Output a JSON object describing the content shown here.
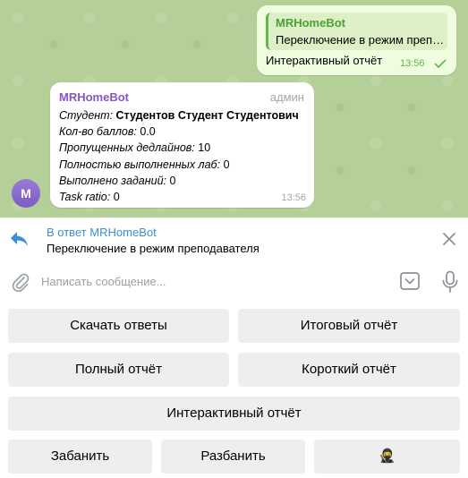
{
  "outgoing": {
    "reply_name": "MRHomeBot",
    "reply_text": "Переключение в режим преподавателя",
    "text": "Интерактивный отчёт",
    "time": "13:56"
  },
  "incoming": {
    "sender": "MRHomeBot",
    "role": "админ",
    "lines": [
      {
        "key": "Студент:",
        "value": "Студентов Студент Студентович",
        "bold": true
      },
      {
        "key": "Кол-во баллов:",
        "value": "0.0"
      },
      {
        "key": "Пропущенных дедлайнов:",
        "value": "10"
      },
      {
        "key": "Полностью выполненных лаб:",
        "value": "0"
      },
      {
        "key": "Выполнено заданий:",
        "value": "0"
      },
      {
        "key": "Task ratio:",
        "value": "0"
      }
    ],
    "time": "13:56",
    "avatar_letter": "M"
  },
  "reply_bar": {
    "title": "В ответ MRHomeBot",
    "text": "Переключение в режим преподавателя"
  },
  "composer": {
    "placeholder": "Написать сообщение...",
    "value": ""
  },
  "keyboard": {
    "row1": [
      "Скачать ответы",
      "Итоговый отчёт"
    ],
    "row2": [
      "Полный отчёт",
      "Короткий отчёт"
    ],
    "row3": [
      "Интерактивный отчёт"
    ],
    "row4": [
      "Забанить",
      "Разбанить",
      "🥷"
    ]
  },
  "colors": {
    "wallpaper": "#b5cf99",
    "outgoing_bubble": "#effdde",
    "accent_green": "#4aa232",
    "sender_purple": "#8656c6",
    "link_blue": "#3a8ed8",
    "button_bg": "#eeeeee"
  },
  "icons": {
    "reply": "reply-arrow-icon",
    "close": "close-icon",
    "attach": "paperclip-icon",
    "keyboard": "keyboard-toggle-icon",
    "mic": "microphone-icon",
    "read": "check-icon"
  }
}
